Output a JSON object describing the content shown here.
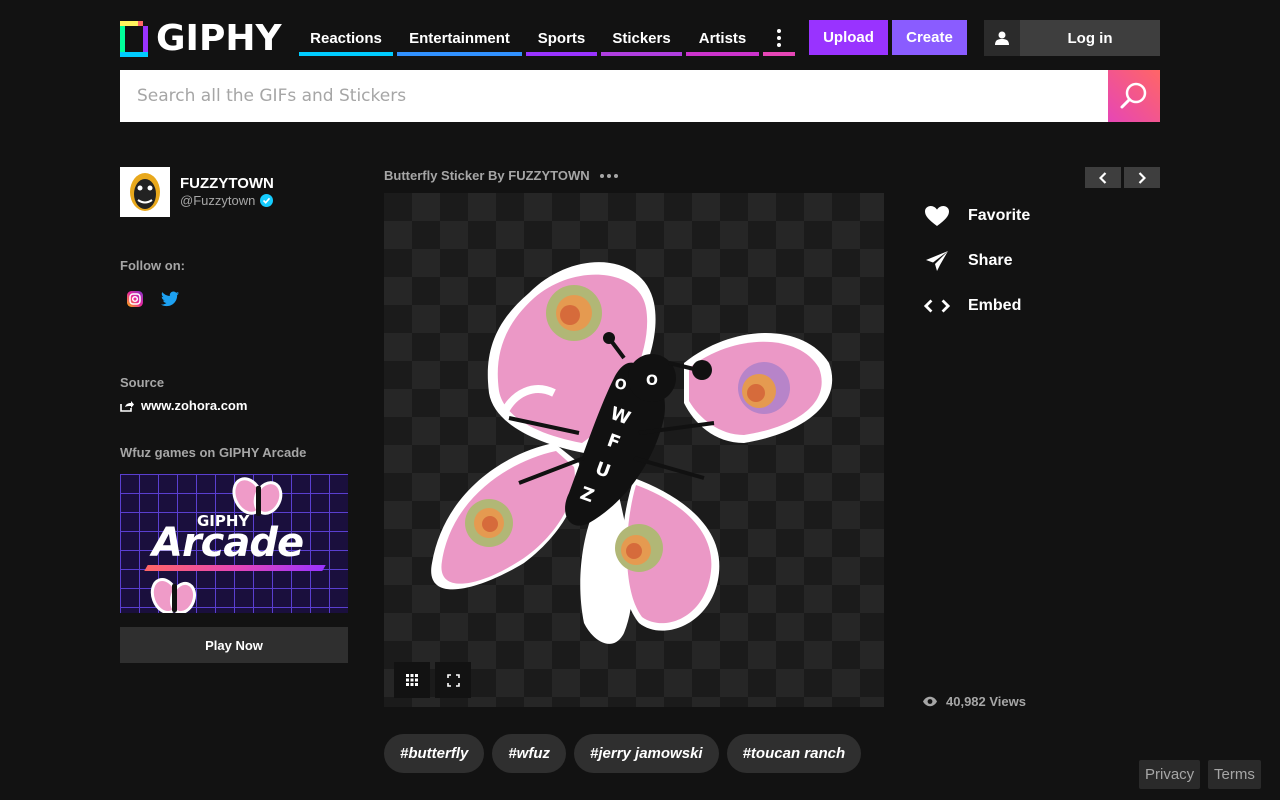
{
  "header": {
    "logo_text": "GIPHY",
    "nav": [
      "Reactions",
      "Entertainment",
      "Sports",
      "Stickers",
      "Artists"
    ],
    "upload_label": "Upload",
    "create_label": "Create",
    "login_label": "Log in"
  },
  "search": {
    "placeholder": "Search all the GIFs and Stickers"
  },
  "user": {
    "name": "FUZZYTOWN",
    "handle": "@Fuzzytown"
  },
  "follow": {
    "label": "Follow on:"
  },
  "source": {
    "label": "Source",
    "link": "www.zohora.com"
  },
  "arcade": {
    "label": "Wfuz games on GIPHY Arcade",
    "small_text": "GIPHY",
    "big_text": "Arcade",
    "play_label": "Play Now"
  },
  "gif": {
    "title": "Butterfly Sticker By FUZZYTOWN",
    "sticker_text": "WFUZ"
  },
  "actions": {
    "favorite": "Favorite",
    "share": "Share",
    "embed": "Embed"
  },
  "views": "40,982 Views",
  "tags": [
    "#butterfly",
    "#wfuz",
    "#jerry jamowski",
    "#toucan ranch"
  ],
  "footer": {
    "privacy": "Privacy",
    "terms": "Terms"
  },
  "colors": {
    "background": "#121212",
    "accent_purple": "#9933ff",
    "search_gradient_start": "#e646b6",
    "search_gradient_end": "#ff6666",
    "verified_blue": "#15cdff"
  },
  "icons": {
    "search": "search-icon",
    "user": "user-icon",
    "more": "more-vertical-icon",
    "heart": "heart-icon",
    "share": "paper-plane-icon",
    "embed": "code-icon",
    "eye": "eye-icon"
  }
}
